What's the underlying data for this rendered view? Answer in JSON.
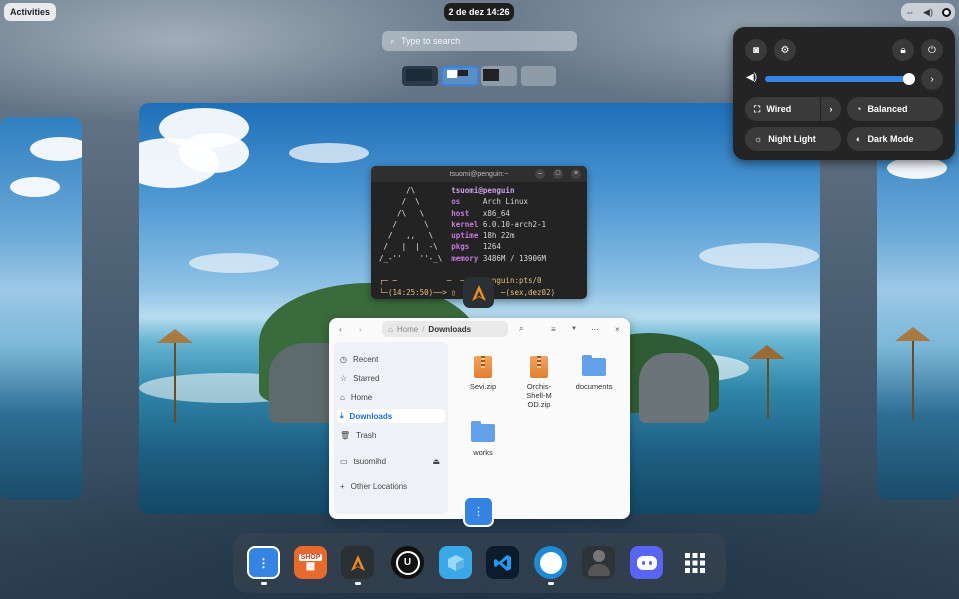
{
  "topbar": {
    "activities": "Activities",
    "clock": "2 de dez  14:26"
  },
  "search": {
    "placeholder": "Type to search"
  },
  "terminal": {
    "title": "tsuomi@penguin:~",
    "user": "tsuomi@penguin",
    "os_label": "os",
    "os": "Arch Linux",
    "host_label": "host",
    "host": "x86_64",
    "kernel_label": "kernel",
    "kernel": "6.0.10-arch2-1",
    "uptime_label": "uptime",
    "uptime": "18h 22m",
    "pkgs_label": "pkgs",
    "pkgs": "1264",
    "memory_label": "memory",
    "memory": "3486M / 13906M",
    "prompt_time": "(14:25:50)",
    "prompt_user": "i penguin:pts/0",
    "prompt_date": "(sex,dez02)"
  },
  "files": {
    "path_home": "Home",
    "path_current": "Downloads",
    "sidebar": [
      {
        "label": "Recent",
        "icon": "clock-icon"
      },
      {
        "label": "Starred",
        "icon": "star-icon"
      },
      {
        "label": "Home",
        "icon": "home-icon"
      },
      {
        "label": "Downloads",
        "icon": "download-icon"
      },
      {
        "label": "Trash",
        "icon": "trash-icon"
      },
      {
        "label": "tsuomihd",
        "icon": "drive-icon"
      },
      {
        "label": "Other Locations",
        "icon": "plus-icon"
      }
    ],
    "items": [
      {
        "label": "Sevi.zip",
        "type": "zip"
      },
      {
        "label": "Orchis-Shell-MOD.zip",
        "type": "zip"
      },
      {
        "label": "documents",
        "type": "folder"
      },
      {
        "label": "works",
        "type": "folder"
      }
    ]
  },
  "quick_settings": {
    "volume_percent": 97,
    "wired": "Wired",
    "balanced": "Balanced",
    "night_light": "Night Light",
    "dark_mode": "Dark Mode"
  },
  "dock": {
    "apps": [
      "files-icon",
      "shop-icon",
      "arch-icon",
      "unreal-icon",
      "box-icon",
      "vscode-icon",
      "bitwarden-icon",
      "lock-person-icon",
      "discord-icon",
      "app-grid-icon"
    ],
    "shop_badge": "SHOP"
  },
  "colors": {
    "accent": "#3584e4",
    "panel": "#242424"
  }
}
